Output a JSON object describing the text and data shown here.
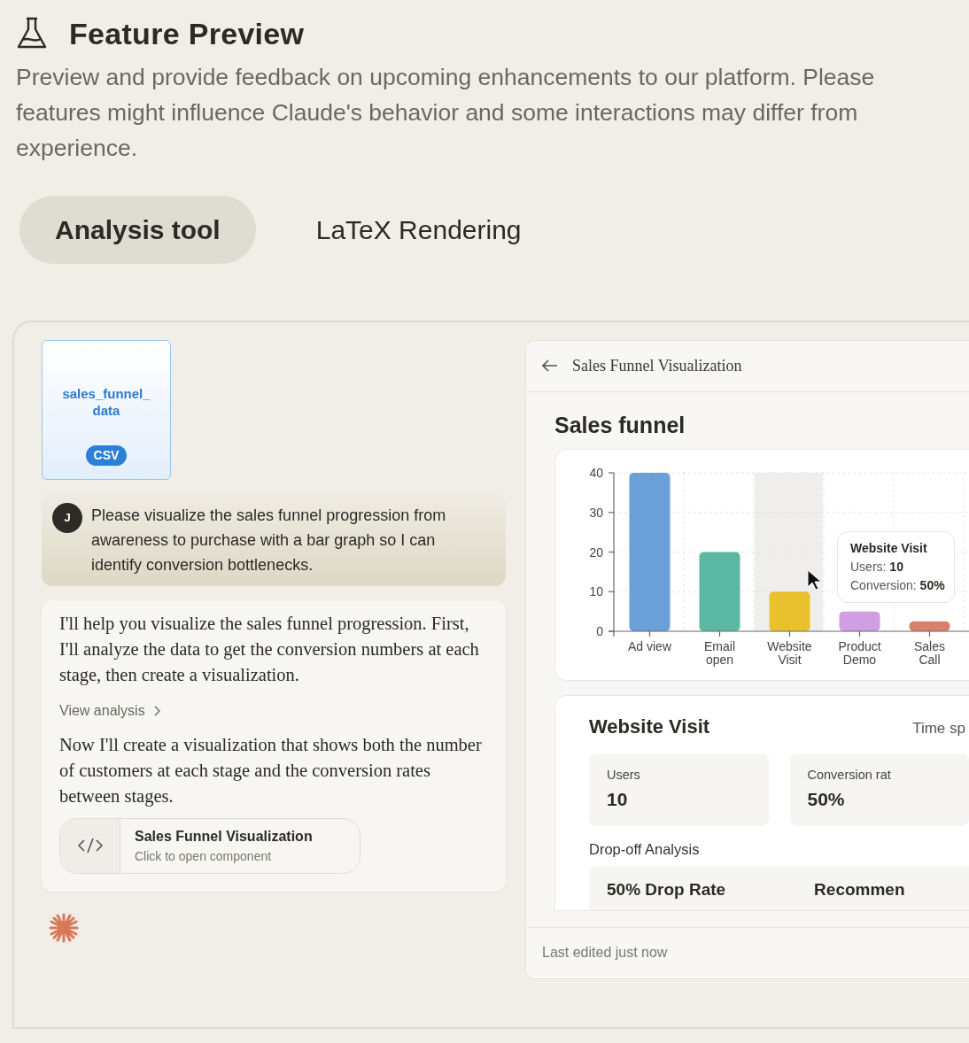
{
  "header": {
    "title": "Feature Preview",
    "description_lines": [
      "Preview and provide feedback on upcoming enhancements to our platform. Please",
      "features might influence Claude's behavior and some interactions may differ from",
      "experience."
    ]
  },
  "tabs": [
    {
      "label": "Analysis tool",
      "selected": true
    },
    {
      "label": "LaTeX Rendering",
      "selected": false
    }
  ],
  "chat": {
    "attachment": {
      "name_lines": [
        "sales_funnel_",
        "data"
      ],
      "type": "CSV"
    },
    "user_message": {
      "avatar": "J",
      "text": "Please visualize the sales funnel progression from awareness to purchase with a bar graph so I can identify conversion bottlenecks."
    },
    "assistant": {
      "paragraph_1": "I'll help you visualize the sales funnel progression. First, I'll analyze the data to get the conversion numbers at each stage, then create a visualization.",
      "link": "View analysis",
      "paragraph_2": "Now I'll create a visualization that shows both the number of customers at each stage and the conversion rates between stages.",
      "artifact": {
        "title": "Sales Funnel Visualization",
        "subtitle": "Click to open component"
      }
    }
  },
  "artifact_panel": {
    "title": "Sales Funnel Visualization",
    "heading": "Sales funnel",
    "chart_data": {
      "type": "bar",
      "categories": [
        "Ad view",
        "Email open",
        "Website Visit",
        "Product Demo",
        "Sales Call"
      ],
      "values": [
        40,
        20,
        10,
        5,
        2.5
      ],
      "ylim": [
        0,
        40
      ],
      "yticks": [
        0,
        10,
        20,
        30,
        40
      ],
      "grid": true
    },
    "bars": [
      {
        "color": "#6a9fd8",
        "selected": false
      },
      {
        "color": "#5bb8a3",
        "selected": false
      },
      {
        "color": "#e9c02e",
        "selected": true
      },
      {
        "color": "#cf9ee3",
        "selected": false
      },
      {
        "color": "#d9806a",
        "selected": false
      }
    ],
    "tooltip": {
      "title": "Website Visit",
      "lines": [
        "Users: **10**",
        "Conversion: **50%**"
      ]
    },
    "detail": {
      "title": "Website Visit",
      "right_label": "Time sp",
      "stats": [
        {
          "label": "Users",
          "value": "10"
        },
        {
          "label": "Conversion rat",
          "value": "50%"
        }
      ],
      "section_label": "Drop-off Analysis",
      "cards": [
        "50% Drop Rate",
        "Recommen"
      ]
    },
    "footer": "Last edited just now"
  }
}
